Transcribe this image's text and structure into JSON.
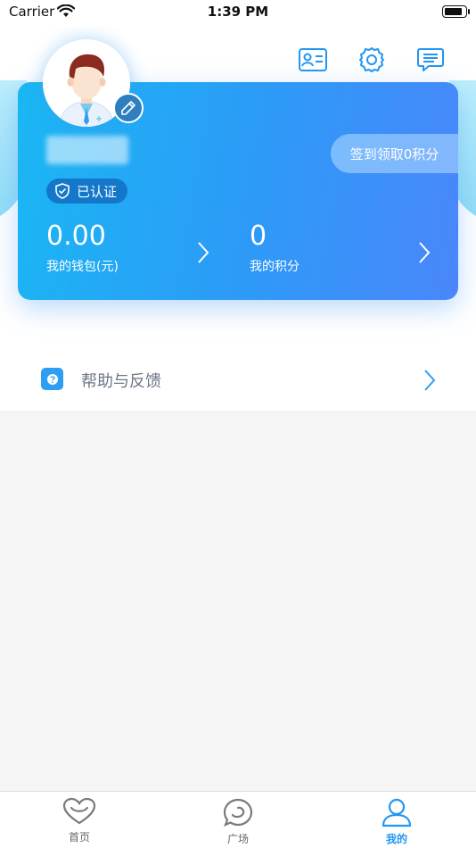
{
  "status_bar": {
    "carrier": "Carrier",
    "time": "1:39 PM",
    "battery_level": 0.85
  },
  "header": {
    "icons": [
      "id-card-icon",
      "settings-gear-icon",
      "message-icon"
    ]
  },
  "profile": {
    "verified_label": "已认证",
    "checkin_label": "签到领取0积分",
    "wallet": {
      "value": "0.00",
      "label": "我的钱包(元)"
    },
    "points": {
      "value": "0",
      "label": "我的积分"
    }
  },
  "menu": {
    "help_label": "帮助与反馈"
  },
  "tab_bar": {
    "tabs": [
      {
        "label": "首页",
        "icon": "heart-icon",
        "active": false
      },
      {
        "label": "广场",
        "icon": "chat-bubble-icon",
        "active": false
      },
      {
        "label": "我的",
        "icon": "user-icon",
        "active": true
      }
    ]
  },
  "colors": {
    "accent": "#2196f3",
    "card_start": "#1ab7f3",
    "card_end": "#4a86fb"
  }
}
